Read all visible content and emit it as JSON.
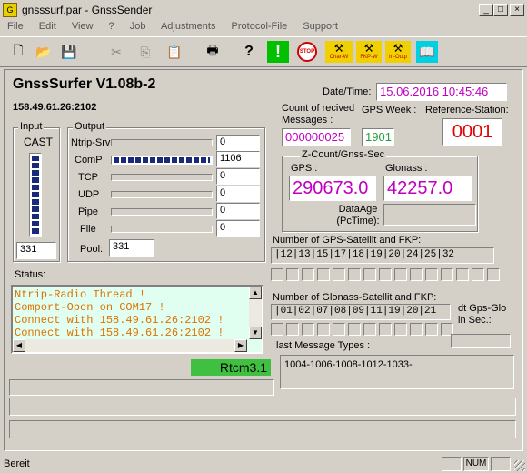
{
  "window": {
    "title": "gnsssurf.par - GnssSender"
  },
  "menu": [
    "File",
    "Edit",
    "View",
    "?",
    "Job",
    "Adjustments",
    "Protocol-File",
    "Support"
  ],
  "toolbar": {
    "icons": [
      "new-file-icon",
      "open-folder-icon",
      "save-icon",
      "cut-icon",
      "copy-icon",
      "paste-icon",
      "print-icon",
      "help-icon",
      "alert-icon",
      "stop-icon",
      "char-w-icon",
      "fkp-w-icon",
      "in-outp-icon",
      "book-icon"
    ],
    "stop_label": "STOP",
    "char_w_label": "Char-W",
    "fkp_w_label": "FKP-W",
    "in_outp_label": "In-Outp",
    "alert_label": "!",
    "help_label": "?"
  },
  "app": {
    "name": "GnssSurfer V1.08b-2",
    "address": "158.49.61.26:2102"
  },
  "datetime": {
    "label": "Date/Time:",
    "value": "15.06.2016  10:45:46"
  },
  "count": {
    "label": "Count of recived Messages :",
    "value": "000000025"
  },
  "gps_week": {
    "label": "GPS Week :",
    "value": "1901"
  },
  "reference_station": {
    "label": "Reference-Station:",
    "value": "0001"
  },
  "input": {
    "label": "Input",
    "type": "CAST",
    "level": 1.0,
    "value": "331"
  },
  "output": {
    "label": "Output",
    "rows": [
      {
        "label": "Ntrip-Srv",
        "value": "0"
      },
      {
        "label": "ComP",
        "value": "1106"
      },
      {
        "label": "TCP",
        "value": "0"
      },
      {
        "label": "UDP",
        "value": "0"
      },
      {
        "label": "Pipe",
        "value": "0"
      },
      {
        "label": "File",
        "value": "0"
      }
    ],
    "pool_label": "Pool:",
    "pool_value": "331"
  },
  "zcount": {
    "label": "Z-Count/Gnss-Sec",
    "gps_label": "GPS :",
    "gps_value": "290673.0",
    "glonass_label": "Glonass :",
    "glonass_value": "42257.0",
    "dataage_label": "DataAge (PcTime):",
    "dataage_value": ""
  },
  "gps_sats": {
    "label": "Number of GPS-Satellit and FKP:",
    "value": "|12|13|15|17|18|19|20|24|25|32"
  },
  "glonass_sats": {
    "label": "Number of Glonass-Satellit and FKP:",
    "value": "|01|02|07|08|09|11|19|20|21"
  },
  "dt": {
    "label": "dt Gps-Glo in Sec.:",
    "value": ""
  },
  "last_message": {
    "label": "last Message Types :",
    "value": "1004-1006-1008-1012-1033-"
  },
  "status": {
    "label": "Status:",
    "lines": [
      "Ntrip-Radio Thread !",
      "Comport-Open on COM17 !",
      "Connect with 158.49.61.26:2102 !",
      "Connect with 158.49.61.26:2102 !"
    ]
  },
  "protocol": "Rtcm3.1",
  "statusbar": {
    "text": "Bereit",
    "num": "NUM"
  },
  "colors": {
    "status_bg": "#e0fff0",
    "status_text": "#e07000",
    "magenta": "#c000c0",
    "red": "#e00000",
    "green_badge": "#40c040",
    "progress": "#1a2a7a"
  }
}
